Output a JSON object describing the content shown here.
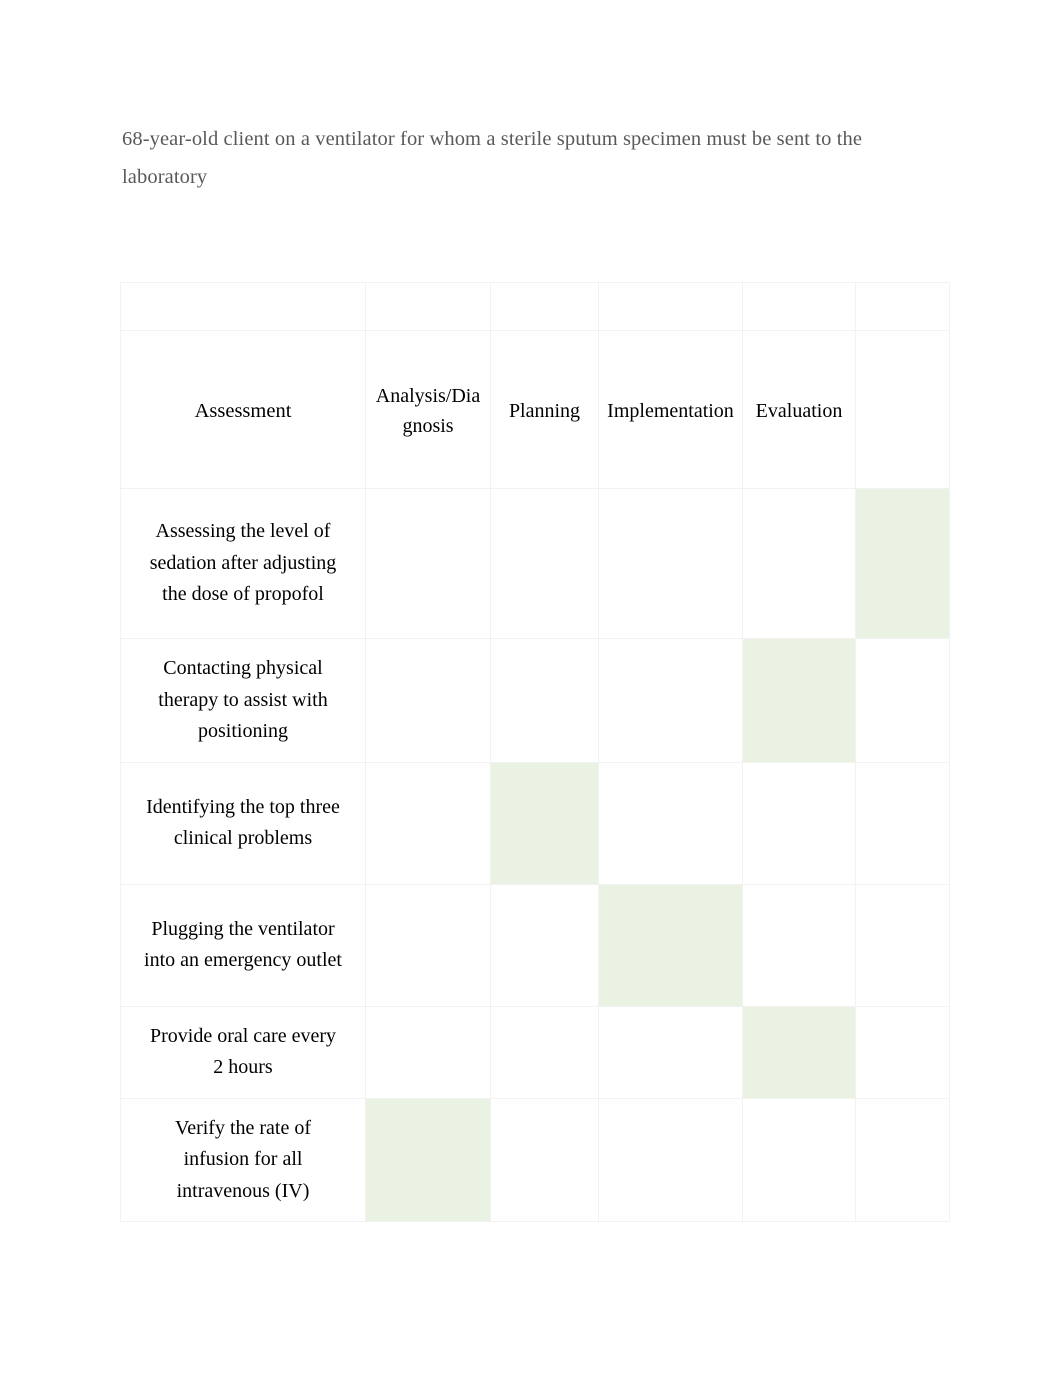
{
  "heading": {
    "text": "68-year-old client on a ventilator for whom a sterile sputum specimen must be sent to the laboratory"
  },
  "table": {
    "columns": [
      {
        "key": "assessment",
        "label": "Assessment"
      },
      {
        "key": "analysis",
        "label": "Analysis/Diagnosis"
      },
      {
        "key": "planning",
        "label": "Planning"
      },
      {
        "key": "implementation",
        "label": "Implementation"
      },
      {
        "key": "evaluation",
        "label": "Evaluation"
      },
      {
        "key": "extra",
        "label": ""
      }
    ],
    "highlight_color": "#eaf3e3",
    "gridline_color": "#f2f2f2",
    "rows": [
      {
        "task": "Assessing the level of sedation after adjusting the dose of propofol",
        "selected_column": "extra",
        "marks": [
          "",
          "",
          "",
          "",
          "",
          ""
        ]
      },
      {
        "task": "Contacting physical therapy to assist with positioning",
        "selected_column": "evaluation",
        "marks": [
          "",
          "",
          "",
          "",
          "",
          ""
        ]
      },
      {
        "task": "Identifying the top three clinical problems",
        "selected_column": "planning",
        "marks": [
          "",
          "",
          "",
          "",
          "",
          ""
        ]
      },
      {
        "task": "Plugging the ventilator into an emergency outlet",
        "selected_column": "implementation",
        "marks": [
          "",
          "",
          "",
          "",
          "",
          ""
        ]
      },
      {
        "task": "Provide oral care every 2 hours",
        "selected_column": "evaluation",
        "marks": [
          "",
          "",
          "",
          "",
          "",
          ""
        ]
      },
      {
        "task": "Verify the rate of infusion for all intravenous (IV)",
        "selected_column": "analysis",
        "marks": [
          "",
          "",
          "",
          "",
          "",
          ""
        ]
      }
    ]
  }
}
